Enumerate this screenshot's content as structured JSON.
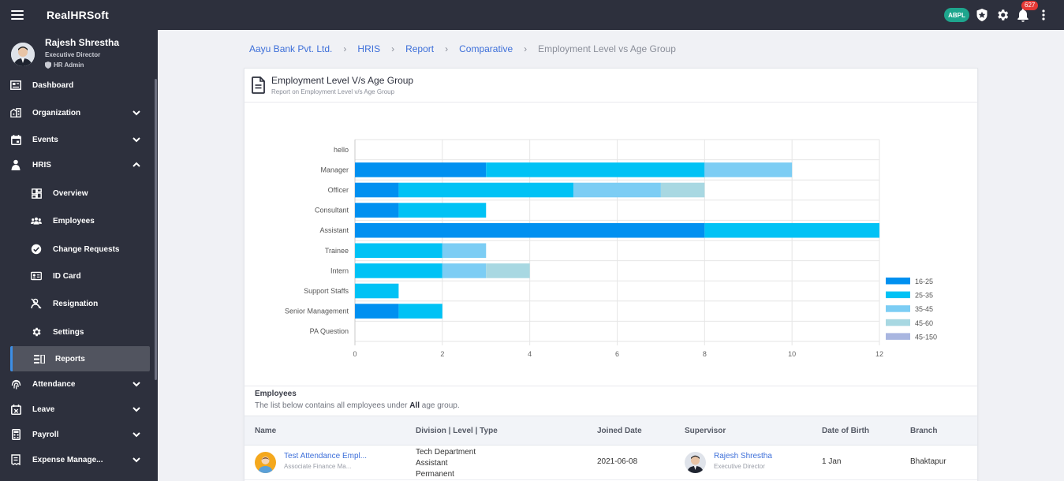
{
  "app": {
    "brand": "RealHRSoft",
    "company_badge": "ABPL",
    "notification_count": "627"
  },
  "user": {
    "name": "Rajesh Shrestha",
    "role": "Executive Director",
    "admin_label": "HR Admin"
  },
  "sidebar": {
    "items": [
      {
        "label": "Dashboard",
        "icon": "dashboard-icon"
      },
      {
        "label": "Organization",
        "icon": "organization-icon",
        "expandable": true
      },
      {
        "label": "Events",
        "icon": "calendar-icon",
        "expandable": true
      },
      {
        "label": "HRIS",
        "icon": "hris-icon",
        "expanded": true
      },
      {
        "label": "Overview",
        "icon": "overview-icon",
        "sub": true
      },
      {
        "label": "Employees",
        "icon": "employees-icon",
        "sub": true
      },
      {
        "label": "Change Requests",
        "icon": "change-requests-icon",
        "sub": true
      },
      {
        "label": "ID Card",
        "icon": "id-card-icon",
        "sub": true
      },
      {
        "label": "Resignation",
        "icon": "resignation-icon",
        "sub": true
      },
      {
        "label": "Settings",
        "icon": "settings-icon",
        "sub": true
      },
      {
        "label": "Reports",
        "icon": "reports-icon",
        "sub": true,
        "active": true
      },
      {
        "label": "Attendance",
        "icon": "fingerprint-icon",
        "expandable": true
      },
      {
        "label": "Leave",
        "icon": "leave-icon",
        "expandable": true
      },
      {
        "label": "Payroll",
        "icon": "payroll-icon",
        "expandable": true
      },
      {
        "label": "Expense Manage...",
        "icon": "expense-icon",
        "expandable": true
      }
    ]
  },
  "breadcrumb": [
    "Aayu Bank Pvt. Ltd.",
    "HRIS",
    "Report",
    "Comparative",
    "Employment Level vs Age Group"
  ],
  "card": {
    "title": "Employment Level V/s Age Group",
    "subtitle": "Report on Employment Level v/s Age Group"
  },
  "chart_data": {
    "type": "bar",
    "orientation": "horizontal",
    "stacked": true,
    "categories": [
      "hello",
      "Manager",
      "Officer",
      "Consultant",
      "Assistant",
      "Trainee",
      "Intern",
      "Support Staffs",
      "Senior Management",
      "PA Question"
    ],
    "series": [
      {
        "name": "16-25",
        "color": "#0090f0",
        "values": [
          0,
          3,
          1,
          1,
          8,
          0,
          0,
          0,
          1,
          0
        ]
      },
      {
        "name": "25-35",
        "color": "#00c2f5",
        "values": [
          0,
          5,
          4,
          2,
          4,
          2,
          2,
          1,
          1,
          0
        ]
      },
      {
        "name": "35-45",
        "color": "#7ccdf4",
        "values": [
          0,
          2,
          2,
          0,
          0,
          1,
          1,
          0,
          0,
          0
        ]
      },
      {
        "name": "45-60",
        "color": "#a8d8e2",
        "values": [
          0,
          0,
          1,
          0,
          0,
          0,
          1,
          0,
          0,
          0
        ]
      },
      {
        "name": "45-150",
        "color": "#a9b6e0",
        "values": [
          0,
          0,
          0,
          0,
          0,
          0,
          0,
          0,
          0,
          0
        ]
      }
    ],
    "xlim": [
      0,
      12
    ],
    "xticks": [
      "0",
      "2",
      "4",
      "6",
      "8",
      "10",
      "12"
    ],
    "grid": true,
    "legend": "right"
  },
  "employees": {
    "title": "Employees",
    "desc_prefix": "The list below contains all employees under",
    "desc_bold": "All",
    "desc_suffix": "age group.",
    "columns": [
      "Name",
      "Division | Level | Type",
      "Joined Date",
      "Supervisor",
      "Date of Birth",
      "Branch"
    ],
    "rows": [
      {
        "name": "Test Attendance Empl...",
        "position": "Associate Finance Ma...",
        "division": "Tech Department",
        "level": "Assistant",
        "type": "Permanent",
        "joined": "2021-06-08",
        "supervisor_name": "Rajesh Shrestha",
        "supervisor_role": "Executive Director",
        "dob": "1 Jan",
        "branch": "Bhaktapur"
      }
    ]
  }
}
